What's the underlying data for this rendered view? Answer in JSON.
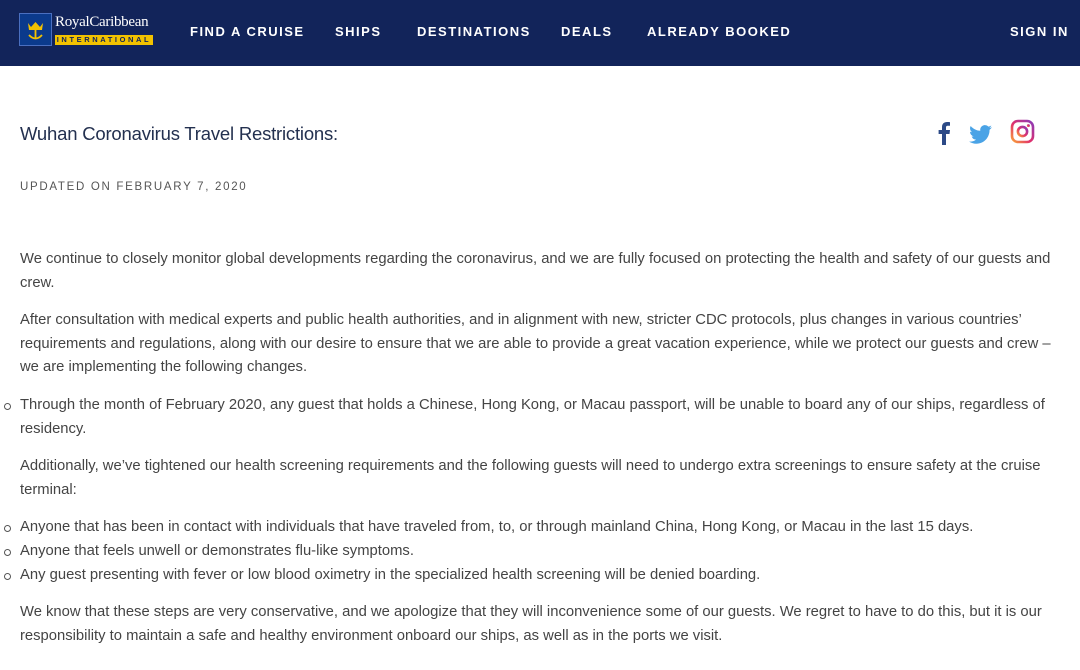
{
  "brand": {
    "name": "RoyalCaribbean",
    "sub": "INTERNATIONAL"
  },
  "nav": {
    "items": [
      "FIND A CRUISE",
      "SHIPS",
      "DESTINATIONS",
      "DEALS",
      "ALREADY BOOKED"
    ],
    "sign_in": "SIGN IN"
  },
  "social": [
    "facebook-icon",
    "twitter-icon",
    "instagram-icon"
  ],
  "article": {
    "title": "Wuhan Coronavirus Travel Restrictions:",
    "updated": "UPDATED ON FEBRUARY 7, 2020",
    "p1": "We continue to closely monitor global developments regarding the coronavirus, and we are fully focused on protecting the health and safety of our guests and crew.",
    "p2": "After consultation with medical experts and public health authorities, and in alignment with new, stricter CDC protocols, plus changes in various countries’ requirements and regulations, along with our desire to ensure that we are able to provide a great vacation experience, while we protect our guests and crew – we are implementing the following changes.",
    "list1": [
      "Through the month of February 2020, any guest that holds a Chinese, Hong Kong, or Macau passport, will be unable to board any of our ships, regardless of residency."
    ],
    "p3": "Additionally, we’ve tightened our health screening requirements and the following guests will need to undergo extra screenings to ensure safety at the cruise terminal:",
    "list2": [
      "Anyone that has been in contact with individuals that have traveled from, to, or through mainland China, Hong Kong, or Macau in the last 15 days.",
      "Anyone that feels unwell or demonstrates flu-like symptoms.",
      "Any guest presenting with fever or low blood oximetry in the specialized health screening will be denied boarding."
    ],
    "p4": "We know that these steps are very conservative, and we apologize that they will inconvenience some of our guests. We regret to have to do this, but it is our responsibility to maintain a safe and healthy environment onboard our ships, as well as in the ports we visit."
  },
  "colors": {
    "header": "#12245a",
    "accent": "#f2c200",
    "facebook": "#2c4a87",
    "twitter": "#4aa3e6"
  }
}
